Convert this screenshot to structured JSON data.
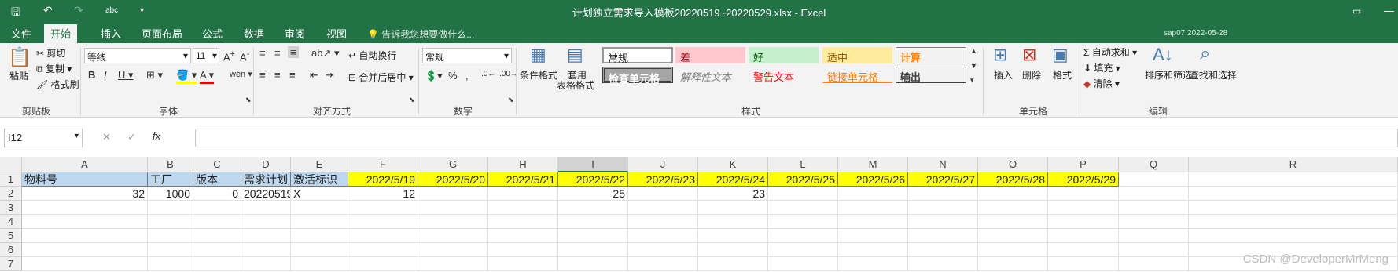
{
  "window": {
    "title": "计划独立需求导入模板20220519~20220529.xlsx - Excel",
    "qat_abc": "abc"
  },
  "tabs": [
    "文件",
    "开始",
    "插入",
    "页面布局",
    "公式",
    "数据",
    "审阅",
    "视图"
  ],
  "tell_me": "告诉我您想要做什么...",
  "user_stamp": "sap07   2022-05-28",
  "ribbon": {
    "clipboard": {
      "label": "剪贴板",
      "paste": "粘贴",
      "cut": "剪切",
      "copy": "复制",
      "format_painter": "格式刷"
    },
    "font": {
      "label": "字体",
      "name": "等线",
      "size": "11"
    },
    "alignment": {
      "label": "对齐方式",
      "wrap": "自动换行",
      "merge": "合并后居中"
    },
    "number": {
      "label": "数字",
      "format": "常规"
    },
    "styles": {
      "label": "样式",
      "conditional": "条件格式",
      "table_format": "套用",
      "table_format2": "表格格式",
      "items": [
        "常规",
        "差",
        "好",
        "适中",
        "计算",
        "检查单元格",
        "解释性文本",
        "警告文本",
        "链接单元格",
        "输出"
      ]
    },
    "cells": {
      "label": "单元格",
      "insert": "插入",
      "delete": "删除",
      "format": "格式"
    },
    "editing": {
      "label": "编辑",
      "autosum": "自动求和",
      "fill": "填充",
      "clear": "清除",
      "sort": "排序和筛选",
      "find": "查找和选择"
    }
  },
  "formula_bar": {
    "name_box": "I12",
    "fx": "fx",
    "formula": ""
  },
  "columns": [
    "A",
    "B",
    "C",
    "D",
    "E",
    "F",
    "G",
    "H",
    "I",
    "J",
    "K",
    "L",
    "M",
    "N",
    "O",
    "P",
    "Q",
    "R"
  ],
  "rows": [
    "1",
    "2",
    "3",
    "4",
    "5",
    "6",
    "7"
  ],
  "header_row": [
    "物料号",
    "工厂",
    "版本",
    "需求计划",
    "激活标识",
    "2022/5/19",
    "2022/5/20",
    "2022/5/21",
    "2022/5/22",
    "2022/5/23",
    "2022/5/24",
    "2022/5/25",
    "2022/5/26",
    "2022/5/27",
    "2022/5/28",
    "2022/5/29"
  ],
  "data_row": [
    "32",
    "1000",
    "0",
    "20220519",
    "X",
    "12",
    "",
    "",
    "25",
    "",
    "23",
    "",
    "",
    "",
    "",
    ""
  ],
  "watermark": "CSDN @DeveloperMrMeng",
  "colors": {
    "excel_green": "#217346",
    "header_fill": "#bdd7ee",
    "highlight": "#ffff00"
  }
}
